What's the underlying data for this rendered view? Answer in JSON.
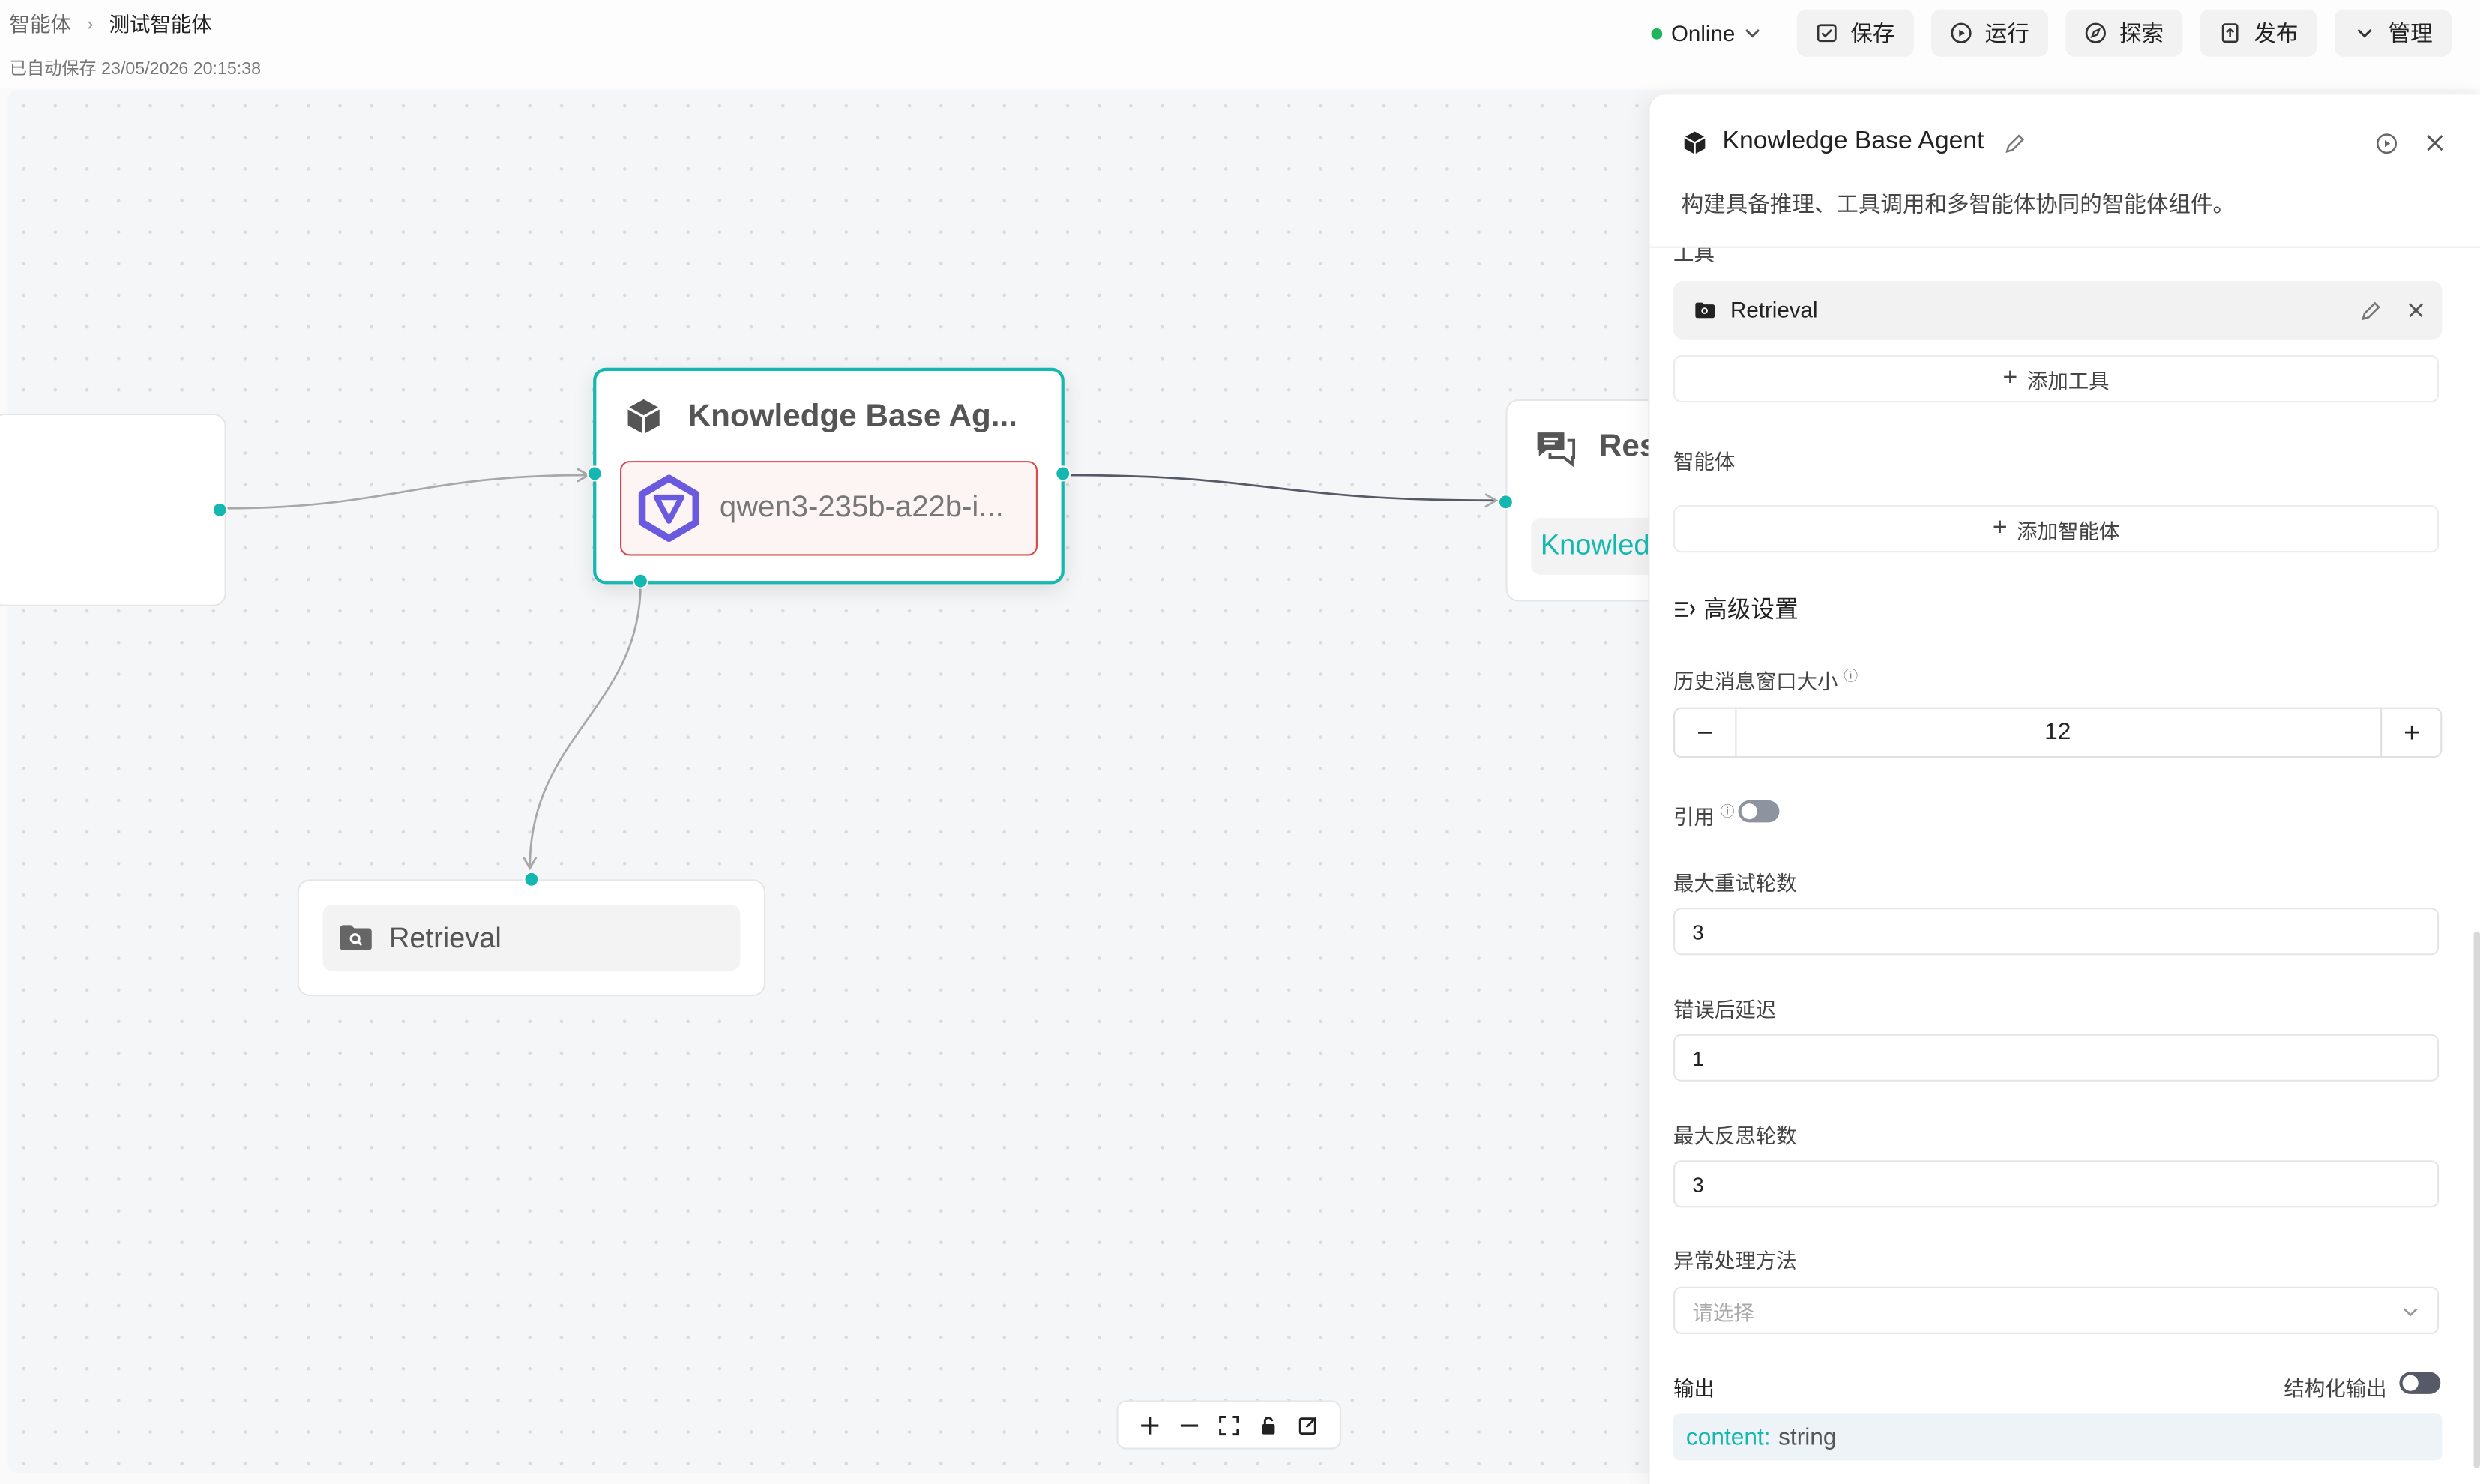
{
  "header": {
    "breadcrumb_root": "智能体",
    "breadcrumb_current": "测试智能体",
    "autosave": "已自动保存 23/05/2026 20:15:38",
    "status": "Online",
    "save": "保存",
    "run": "运行",
    "explore": "探索",
    "publish": "发布",
    "manage": "管理"
  },
  "canvas": {
    "agent_node": {
      "title": "Knowledge Base Ag...",
      "model": "qwen3-235b-a22b-i..."
    },
    "response_node": {
      "title": "Res",
      "tag": "Knowled"
    },
    "retrieval_node": {
      "title": "Retrieval"
    }
  },
  "panel": {
    "title": "Knowledge Base Agent",
    "description": "构建具备推理、工具调用和多智能体协同的智能体组件。",
    "tools_label": "工具",
    "tool_item": "Retrieval",
    "add_tool": "添加工具",
    "agents_label": "智能体",
    "add_agent": "添加智能体",
    "advanced": "高级设置",
    "history_label": "历史消息窗口大小",
    "history_value": "12",
    "cite_label": "引用",
    "max_retries_label": "最大重试轮数",
    "max_retries": "3",
    "delay_label": "错误后延迟",
    "delay": "1",
    "max_reflect_label": "最大反思轮数",
    "max_reflect": "3",
    "exception_label": "异常处理方法",
    "exception_placeholder": "请选择",
    "output_label": "输出",
    "structured_label": "结构化输出",
    "output_key": "content:",
    "output_type": "string"
  },
  "colors": {
    "accent": "#14b8b0",
    "model_border": "#d8474d",
    "online": "#22b35e"
  }
}
